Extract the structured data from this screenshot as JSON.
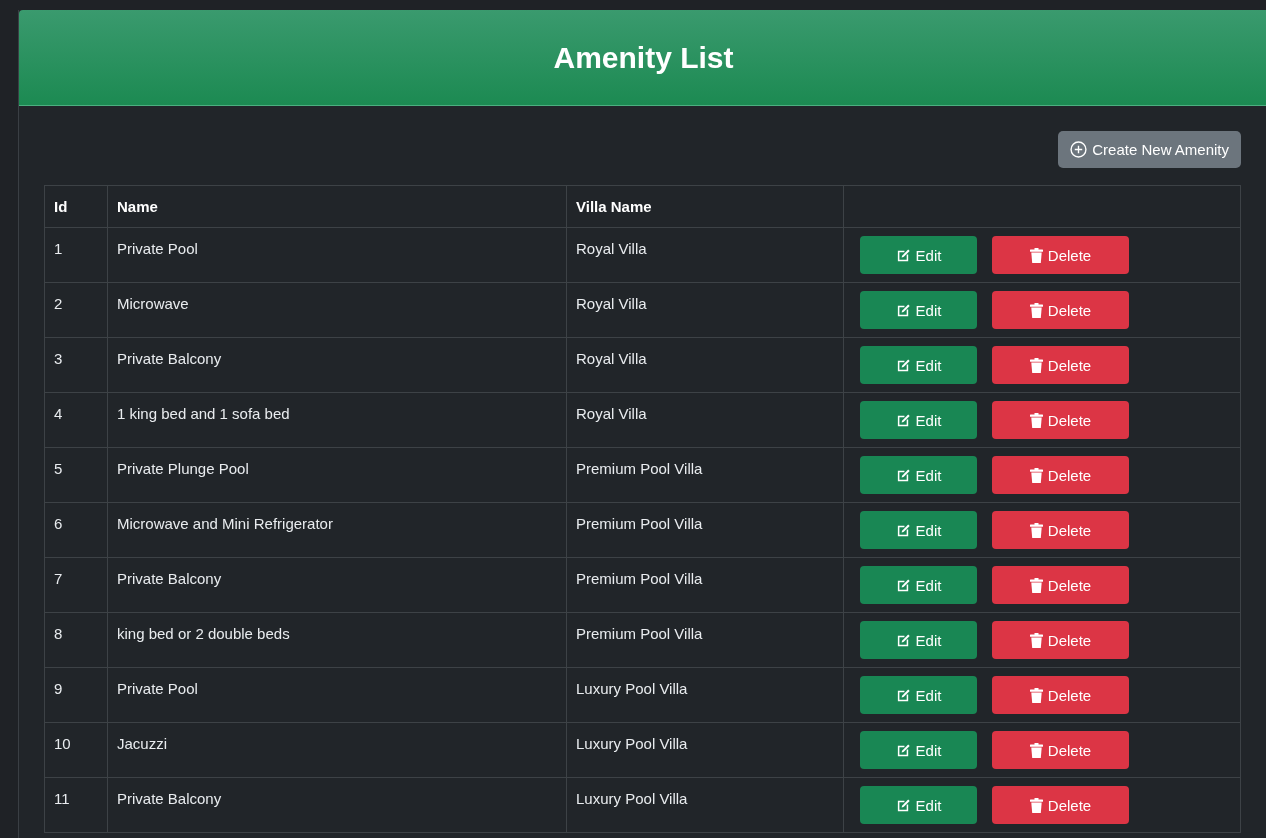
{
  "header": {
    "title": "Amenity List"
  },
  "create_button": {
    "label": "Create New Amenity"
  },
  "table": {
    "columns": [
      "Id",
      "Name",
      "Villa Name"
    ],
    "rows": [
      {
        "id": "1",
        "name": "Private Pool",
        "villa_name": "Royal Villa",
        "actions": [
          {
            "kind": "edit",
            "label": "Edit"
          },
          {
            "kind": "delete",
            "label": "Delete"
          }
        ]
      },
      {
        "id": "2",
        "name": "Microwave",
        "villa_name": "Royal Villa",
        "actions": [
          {
            "kind": "edit",
            "label": "Edit"
          },
          {
            "kind": "delete",
            "label": "Delete"
          }
        ]
      },
      {
        "id": "3",
        "name": "Private Balcony",
        "villa_name": "Royal Villa",
        "actions": [
          {
            "kind": "edit",
            "label": "Edit"
          },
          {
            "kind": "delete",
            "label": "Delete"
          }
        ]
      },
      {
        "id": "4",
        "name": "1 king bed and 1 sofa bed",
        "villa_name": "Royal Villa",
        "actions": [
          {
            "kind": "edit",
            "label": "Edit"
          },
          {
            "kind": "delete",
            "label": "Delete"
          }
        ]
      },
      {
        "id": "5",
        "name": "Private Plunge Pool",
        "villa_name": "Premium Pool Villa",
        "actions": [
          {
            "kind": "edit",
            "label": "Edit"
          },
          {
            "kind": "delete",
            "label": "Delete"
          }
        ]
      },
      {
        "id": "6",
        "name": "Microwave and Mini Refrigerator",
        "villa_name": "Premium Pool Villa",
        "actions": [
          {
            "kind": "edit",
            "label": "Edit"
          },
          {
            "kind": "delete",
            "label": "Delete"
          }
        ]
      },
      {
        "id": "7",
        "name": "Private Balcony",
        "villa_name": "Premium Pool Villa",
        "actions": [
          {
            "kind": "edit",
            "label": "Edit"
          },
          {
            "kind": "delete",
            "label": "Delete"
          }
        ]
      },
      {
        "id": "8",
        "name": "king bed or 2 double beds",
        "villa_name": "Premium Pool Villa",
        "actions": [
          {
            "kind": "edit",
            "label": "Edit"
          },
          {
            "kind": "delete",
            "label": "Delete"
          }
        ]
      },
      {
        "id": "9",
        "name": "Private Pool",
        "villa_name": "Luxury Pool Villa",
        "actions": [
          {
            "kind": "edit",
            "label": "Edit"
          },
          {
            "kind": "delete",
            "label": "Delete"
          }
        ]
      },
      {
        "id": "10",
        "name": "Jacuzzi",
        "villa_name": "Luxury Pool Villa",
        "actions": [
          {
            "kind": "edit",
            "label": "Edit"
          },
          {
            "kind": "delete",
            "label": "Delete"
          }
        ]
      },
      {
        "id": "11",
        "name": "Private Balcony",
        "villa_name": "Luxury Pool Villa",
        "actions": [
          {
            "kind": "edit",
            "label": "Edit"
          },
          {
            "kind": "delete",
            "label": "Delete"
          }
        ]
      }
    ]
  }
}
